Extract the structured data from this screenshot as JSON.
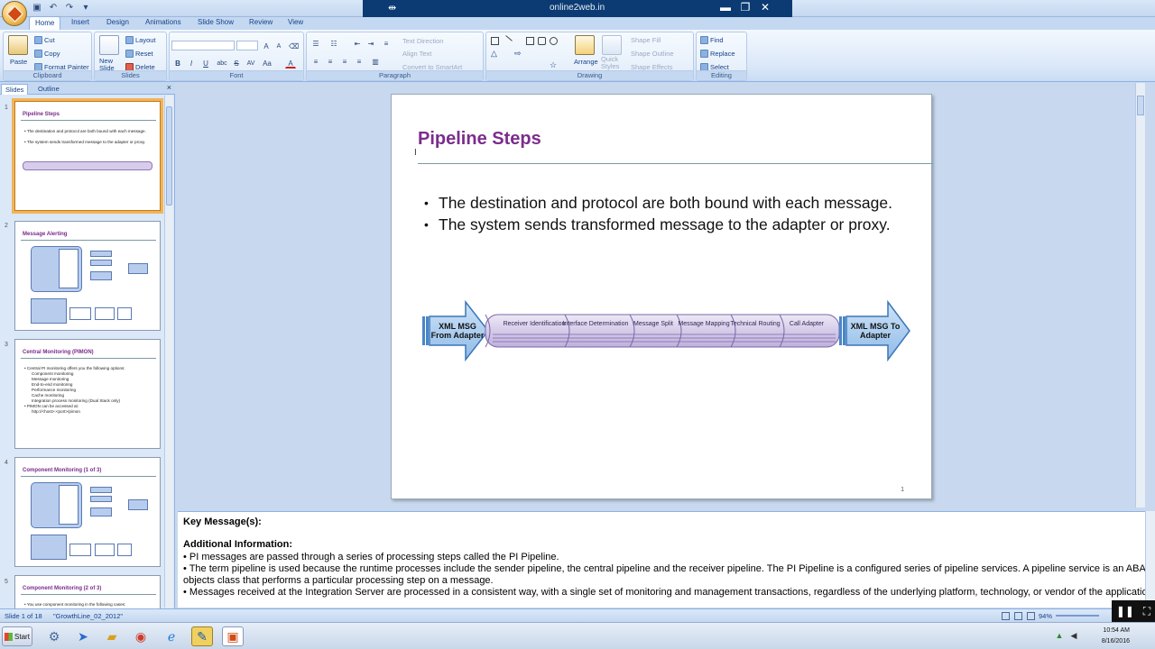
{
  "window": {
    "title_center": "online2web.in",
    "controls": {
      "pin": "⇹",
      "minimize": "▬",
      "restore": "❐",
      "close": "✕"
    }
  },
  "ribbon_tabs": [
    "Home",
    "Insert",
    "Design",
    "Animations",
    "Slide Show",
    "Review",
    "View"
  ],
  "ribbon": {
    "clipboard": {
      "label": "Clipboard",
      "paste": "Paste",
      "cut": "Cut",
      "copy": "Copy",
      "format_painter": "Format Painter"
    },
    "slides": {
      "label": "Slides",
      "new_slide": "New Slide",
      "layout": "Layout",
      "reset": "Reset",
      "delete": "Delete"
    },
    "font": {
      "label": "Font",
      "bold": "B",
      "italic": "I",
      "underline": "U",
      "shadow": "abc",
      "strike": "S",
      "spacing": "AV",
      "case": "Aa",
      "color": "A"
    },
    "paragraph": {
      "label": "Paragraph",
      "text_direction": "Text Direction",
      "align_text": "Align Text",
      "convert_smartart": "Convert to SmartArt"
    },
    "drawing": {
      "label": "Drawing",
      "arrange": "Arrange",
      "quick_styles": "Quick Styles",
      "shape_fill": "Shape Fill",
      "shape_outline": "Shape Outline",
      "shape_effects": "Shape Effects"
    },
    "editing": {
      "label": "Editing",
      "find": "Find",
      "replace": "Replace",
      "select": "Select"
    }
  },
  "left_pane": {
    "tabs": [
      "Slides",
      "Outline"
    ],
    "close": "×",
    "thumbnails": [
      {
        "num": "1",
        "title": "Pipeline Steps",
        "bullets": [
          "The destination and protocol are both bound with each message.",
          "The system sends transformed message to the adapter or proxy."
        ]
      },
      {
        "num": "2",
        "title": "Message Alerting",
        "bullets": []
      },
      {
        "num": "3",
        "title": "Central Monitoring (PIMON)",
        "bullets": [
          "Central PI monitoring offers you the following options:",
          "Component monitoring",
          "Message monitoring",
          "End-to-end monitoring",
          "Performance monitoring",
          "Cache monitoring",
          "Integration process monitoring (Dual Stack only)",
          "PIMON can be accessed at:",
          "http://<host>:<port>/pimon"
        ]
      },
      {
        "num": "4",
        "title": "Component Monitoring (1 of 3)",
        "bullets": []
      },
      {
        "num": "5",
        "title": "Component Monitoring (2 of 3)",
        "bullets": [
          "You use component monitoring in the following cases:"
        ]
      }
    ]
  },
  "slide": {
    "title": "Pipeline Steps",
    "bullets": [
      "The destination and protocol are both bound with each message.",
      "The system sends transformed message to the adapter or proxy."
    ],
    "page_number": "1",
    "diagram": {
      "left_arrow": "XML MSG From Adapter",
      "right_arrow": "XML MSG To Adapter",
      "stages": [
        "Receiver Identification",
        "Interface Determination",
        "Message Split",
        "Message Mapping",
        "Technical Routing",
        "Call Adapter"
      ]
    }
  },
  "notes": {
    "key_message": "Key Message(s):",
    "additional_heading": "Additional Information:",
    "lines": [
      "• PI messages are passed through a series of processing steps called the PI Pipeline.",
      "• The term pipeline is used because  the runtime processes include the sender pipeline, the central pipeline  and the receiver pipeline. The PI Pipeline is a configured series of pipeline services. A pipeline service is an ABAP",
      "   objects class that performs a particular processing step on a message.",
      "• Messages received at the Integration Server are processed in a consistent way, with a single set of monitoring and management  transactions, regardless of the underlying platform, technology, or vendor of the application"
    ]
  },
  "statusbar": {
    "slide_info": "Slide 1 of 18",
    "theme": "\"GrowthLine_02_2012\"",
    "zoom": "94%"
  },
  "taskbar": {
    "start": "Start",
    "time": "10:54 AM",
    "date": "8/16/2016"
  }
}
